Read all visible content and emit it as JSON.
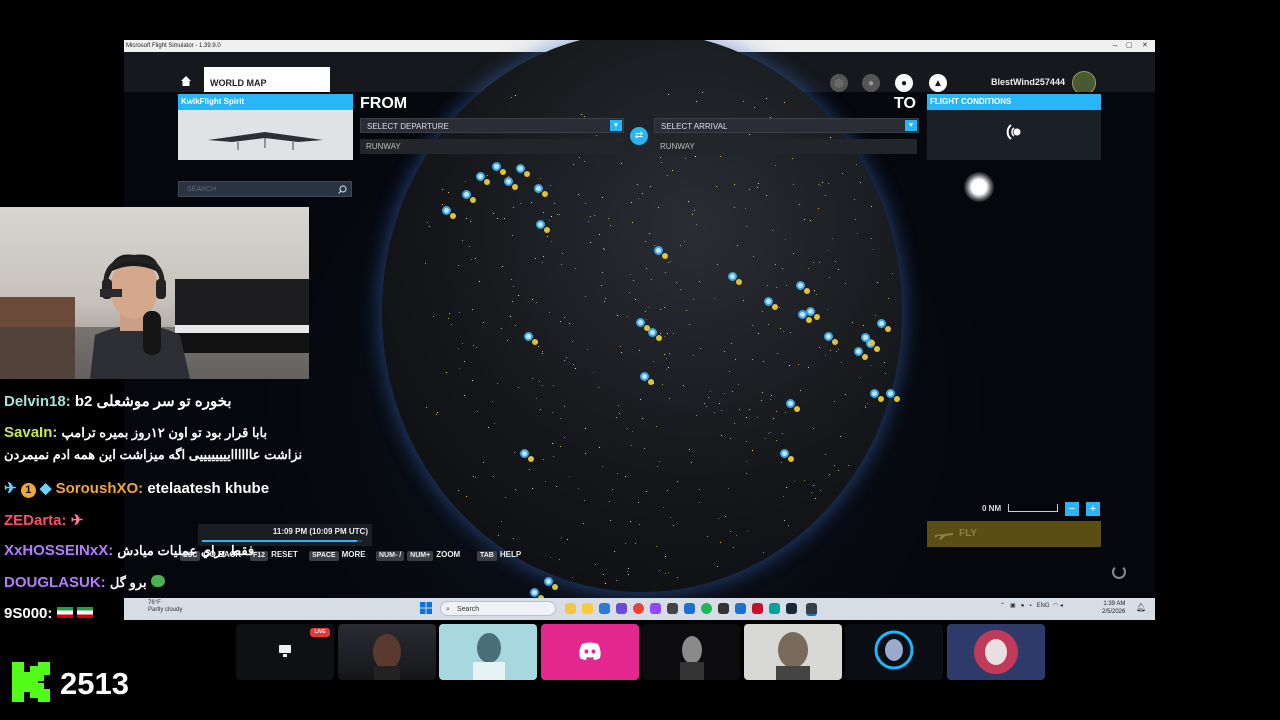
{
  "window": {
    "title": "Microsoft Flight Simulator - 1.39.9.0",
    "controls": [
      "–",
      "▢",
      "✕"
    ]
  },
  "topbar": {
    "tab_label": "WORLD MAP",
    "username": "BlestWind257444",
    "icons": [
      "globe-icon",
      "community-icon",
      "profile-icon",
      "notifications-icon"
    ]
  },
  "flight": {
    "aircraft_label": "KwikFlight Spirit",
    "from_label": "FROM",
    "to_label": "TO",
    "departure_placeholder": "SELECT DEPARTURE",
    "arrival_placeholder": "SELECT ARRIVAL",
    "runway_from": "RUNWAY",
    "runway_to": "RUNWAY",
    "conditions_label": "FLIGHT CONDITIONS"
  },
  "search": {
    "placeholder": "SEARCH"
  },
  "map": {
    "scale_label": "0 NM",
    "zoom_out": "−",
    "zoom_in": "+",
    "fly_label": "FLY",
    "time_text": "11:09 PM (10:09 PM UTC)",
    "time_progress": 0.97
  },
  "hints": [
    {
      "key": "ESC",
      "label": "GO BACK"
    },
    {
      "key": "F12",
      "label": "RESET"
    },
    {
      "key": "SPACE",
      "label": "MORE"
    },
    {
      "key": "NUM- /",
      "key2": "NUM+",
      "label": "ZOOM"
    },
    {
      "key": "TAB",
      "label": "HELP"
    }
  ],
  "taskbar": {
    "weather_temp": "76°F",
    "weather_desc": "Partly cloudy",
    "search_placeholder": "Search",
    "language": "ENG",
    "time": "1:39 AM",
    "date": "2/5/2026"
  },
  "chat": [
    {
      "user": "Delvin18:",
      "color": "#a3e4d7",
      "message": "بخوره تو سر موشعلی b2"
    },
    {
      "user": "SavaIn:",
      "color": "#c5e84c",
      "message": "بابا قرار بود تو اون ۱۲روز بمیره ترامپ",
      "message2": "نزاشت عااااااییییییییی اگه میزاشت این همه ادم نمیمردن"
    },
    {
      "user": "SoroushXO:",
      "color": "#f0a830",
      "message": "etelaatesh khube",
      "badges": [
        "sword-badge-icon",
        "number-one-badge-icon",
        "gem-badge-icon"
      ],
      "badge_text": "1"
    },
    {
      "user": "ZEDarta:",
      "color": "#ff4d6a",
      "message": "",
      "emote": "rocket-emote-icon"
    },
    {
      "user": "XxHOSSEINxX:",
      "color": "#b57cff",
      "message": "فقط براي عمليات ميادش"
    },
    {
      "user": "DOUGLASUK:",
      "color": "#b57cff",
      "message": "برو گل",
      "emote": "pepe-emote-icon"
    },
    {
      "user": "9S000:",
      "color": "#ffffff",
      "message": "",
      "emote": "iran-flag-emote-icon"
    }
  ],
  "viewer_count": "2513",
  "live_badge": "LIVE",
  "thumbnails": [
    "streamer-1",
    "streamer-2",
    "streamer-3",
    "discord-app",
    "streamer-5",
    "streamer-6",
    "streamer-7",
    "streamer-8"
  ],
  "colors": {
    "accent": "#29b6f6",
    "kick_green": "#53fc18",
    "fly": "#5a4e14"
  }
}
